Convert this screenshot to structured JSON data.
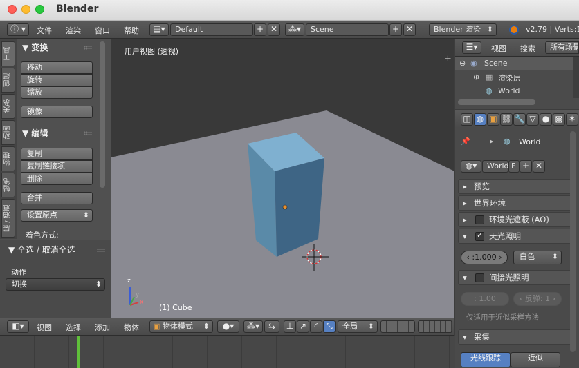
{
  "window": {
    "title": "Blender"
  },
  "top_bar": {
    "menus": [
      "文件",
      "渲染",
      "窗口",
      "帮助"
    ],
    "layout": "Default",
    "scene": "Scene",
    "engine": "Blender 渲染",
    "version": "v2.79 | Verts:1"
  },
  "tool_panel": {
    "tabs": [
      "工具",
      "创建",
      "关系",
      "动画",
      "物理",
      "蜡笔",
      "层 / 通道"
    ],
    "transform_header": "变换",
    "transform_buttons": [
      "移动",
      "旋转",
      "缩放"
    ],
    "mirror": "镜像",
    "edit_header": "编辑",
    "edit_buttons": [
      "复制",
      "复制链接项",
      "删除"
    ],
    "join": "合并",
    "set_origin": "设置原点",
    "shading_label": "着色方式:",
    "select_all_header": "全选 / 取消全选",
    "action_label": "动作",
    "action_value": "切换"
  },
  "viewport": {
    "label": "用户视图 (透视)",
    "object_label": "(1) Cube",
    "axis_x": "x",
    "axis_y": "y",
    "axis_z": "z"
  },
  "viewport_header": {
    "menus": [
      "视图",
      "选择",
      "添加",
      "物体"
    ],
    "mode": "物体模式",
    "pivot": "全局"
  },
  "outliner": {
    "menus": [
      "视图",
      "搜索"
    ],
    "filter": "所有场景",
    "items": [
      "Scene",
      "渲染层",
      "World"
    ]
  },
  "properties": {
    "breadcrumb": "World",
    "world_field": "World",
    "world_f": "F",
    "panels": {
      "preview": "预览",
      "world_env": "世界环境",
      "ao": "环境光遮蔽 (AO)",
      "env_light": "天光照明",
      "indirect": "间接光照明",
      "gather": "采集"
    },
    "env_energy": "1.000",
    "env_color": "白色",
    "indirect_factor": "1.00",
    "indirect_bounces": "反弹: 1",
    "indirect_note": "仅适用于近似采样方法",
    "gather_raytrace": "光线跟踪",
    "gather_approx": "近似"
  },
  "colors": {
    "viewport_bg": "#393939",
    "grid_plane": "#8a8a92",
    "cube_front": "#3e6585",
    "cube_side": "#5a8aa8",
    "cube_top": "#7fb0d0",
    "accent_blue": "#5680c2"
  }
}
